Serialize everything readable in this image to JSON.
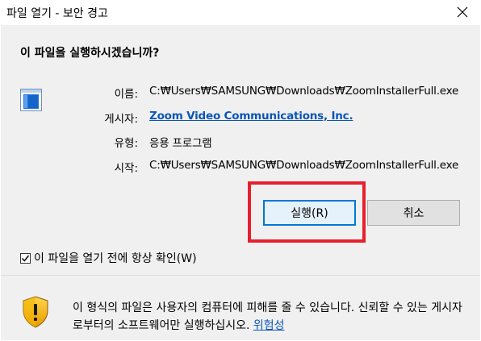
{
  "window": {
    "title": "파일 열기 - 보안 경고",
    "close_icon": "close-icon"
  },
  "dialog": {
    "question": "이 파일을 실행하시겠습니까?",
    "program_icon": "application-window-icon",
    "fields": {
      "name_label": "이름:",
      "name_value": "C:₩Users₩SAMSUNG₩Downloads₩ZoomInstallerFull.exe",
      "publisher_label": "게시자:",
      "publisher_value": "Zoom Video Communications, Inc.",
      "type_label": "유형:",
      "type_value": "응용 프로그램",
      "from_label": "시작:",
      "from_value": "C:₩Users₩SAMSUNG₩Downloads₩ZoomInstallerFull.exe"
    },
    "buttons": {
      "run_label": "실행(R)",
      "cancel_label": "취소"
    },
    "checkbox": {
      "label": "이 파일을 열기 전에 항상 확인(W)",
      "checked": true
    },
    "warning": {
      "icon": "shield-warning-icon",
      "text": "이 형식의 파일은 사용자의 컴퓨터에 피해를 줄 수 있습니다. 신뢰할 수 있는 게시자로부터의 소프트웨어만 실행하십시오.",
      "link_label": "위험성"
    }
  },
  "colors": {
    "accent": "#0078d7",
    "link": "#0b55b8",
    "highlight": "#e81f2f",
    "client_bg": "#f0f0f0"
  }
}
